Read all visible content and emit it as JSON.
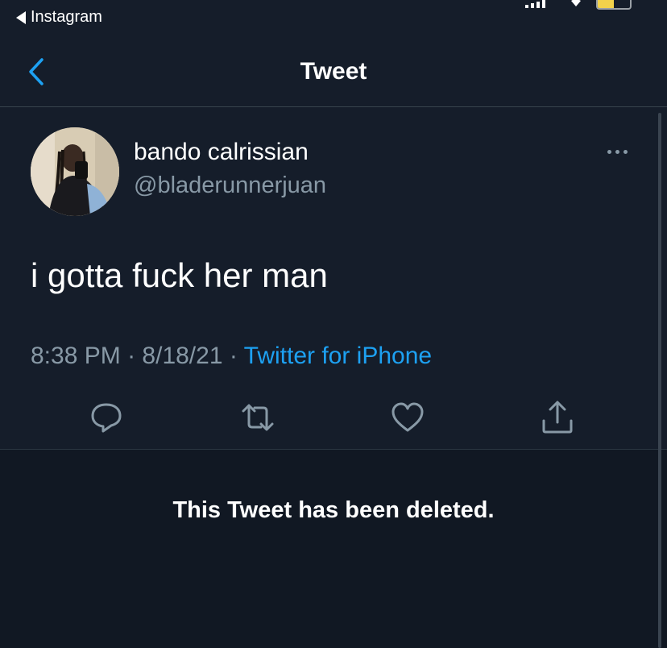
{
  "status_bar": {
    "back_app_label": "Instagram"
  },
  "nav": {
    "title": "Tweet",
    "back_icon": "chevron-left-icon"
  },
  "tweet": {
    "display_name": "bando calrissian",
    "handle": "@bladerunnerjuan",
    "text": "i gotta fuck her man",
    "time": "8:38 PM",
    "separator": "·",
    "date": "8/18/21",
    "source": "Twitter for iPhone"
  },
  "actions": [
    {
      "name": "reply",
      "icon": "reply-icon"
    },
    {
      "name": "retweet",
      "icon": "retweet-icon"
    },
    {
      "name": "like",
      "icon": "heart-icon"
    },
    {
      "name": "share",
      "icon": "share-icon"
    }
  ],
  "deleted_notice": "This Tweet has been deleted.",
  "colors": {
    "background": "#151d2a",
    "secondary_text": "#8899a6",
    "accent": "#1da1f2",
    "divider": "#38444d"
  }
}
